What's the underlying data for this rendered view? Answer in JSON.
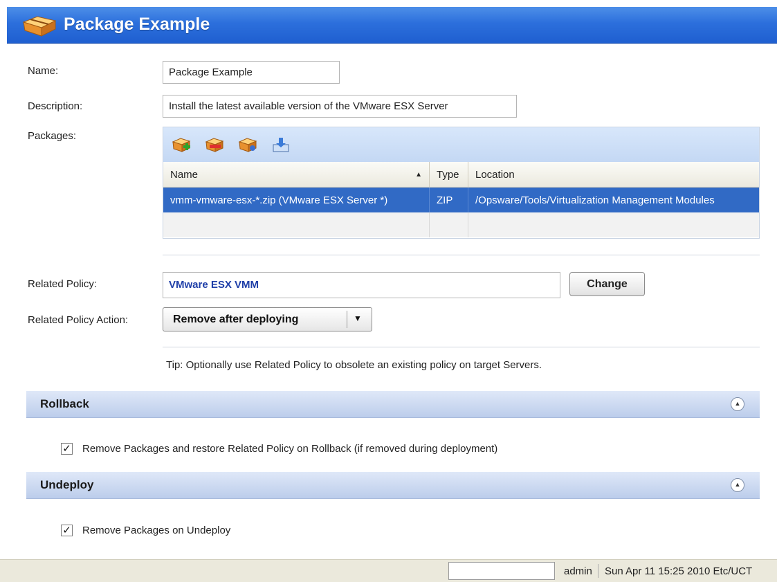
{
  "header": {
    "title": "Package Example",
    "icon": "package-box-icon",
    "bg_color": "#2c6fdc"
  },
  "form": {
    "name_label": "Name:",
    "name_value": "Package Example",
    "description_label": "Description:",
    "description_value": "Install the latest available version of the VMware ESX Server",
    "packages_label": "Packages:"
  },
  "packages_toolbar": {
    "icons": [
      "add-package-icon",
      "remove-package-icon",
      "package-properties-icon",
      "import-package-icon"
    ]
  },
  "packages_table": {
    "columns": [
      "Name",
      "Type",
      "Location"
    ],
    "sort_indicator": "▲",
    "rows": [
      {
        "name": "vmm-vmware-esx-*.zip (VMware ESX Server *)",
        "type": "ZIP",
        "location": "/Opsware/Tools/Virtualization Management Modules",
        "selected": true
      }
    ],
    "selection_color": "#316ac5"
  },
  "related_policy": {
    "label": "Related Policy:",
    "value": "VMware ESX VMM",
    "change_button": "Change",
    "action_label": "Related Policy Action:",
    "action_value": "Remove after deploying",
    "dropdown_arrow": "▼",
    "tip": "Tip: Optionally use Related Policy to obsolete an existing policy on target Servers."
  },
  "rollback": {
    "title": "Rollback",
    "collapse_icon": "double-chevron-up-icon",
    "checkbox_checked": true,
    "checkbox_label": "Remove Packages and restore Related Policy on Rollback (if removed during deployment)"
  },
  "undeploy": {
    "title": "Undeploy",
    "collapse_icon": "double-chevron-up-icon",
    "checkbox_checked": true,
    "checkbox_label": "Remove Packages on Undeploy"
  },
  "statusbar": {
    "user": "admin",
    "datetime": "Sun Apr 11 15:25 2010 Etc/UCT"
  }
}
